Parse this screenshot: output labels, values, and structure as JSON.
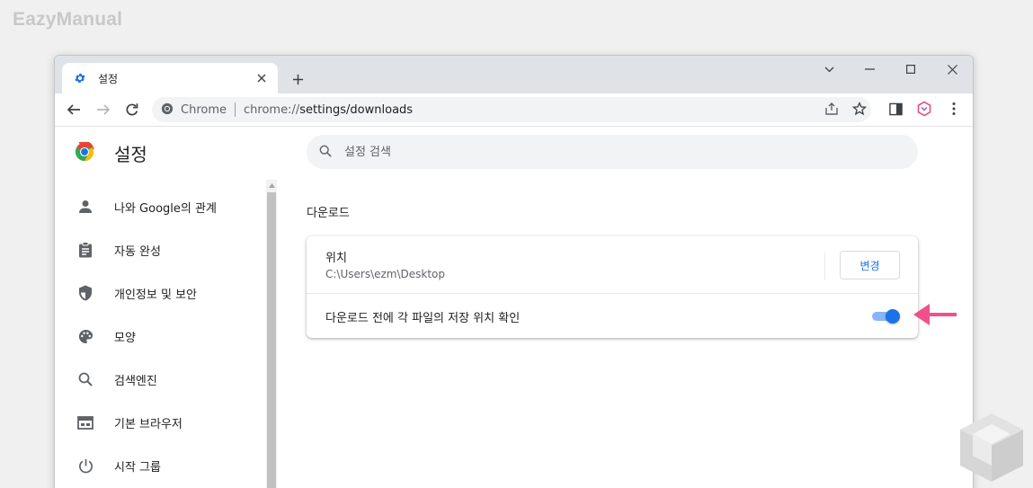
{
  "brand": "EazyManual",
  "browser": {
    "tab_title": "설정",
    "address": {
      "chip": "Chrome",
      "url_prefix": "chrome://",
      "url_path": "settings/downloads"
    }
  },
  "settings": {
    "title": "설정",
    "search_placeholder": "설정 검색",
    "sidebar": [
      {
        "label": "나와 Google의 관계",
        "icon": "person-icon"
      },
      {
        "label": "자동 완성",
        "icon": "clipboard-icon"
      },
      {
        "label": "개인정보 및 보안",
        "icon": "shield-icon"
      },
      {
        "label": "모양",
        "icon": "palette-icon"
      },
      {
        "label": "검색엔진",
        "icon": "search-icon"
      },
      {
        "label": "기본 브라우저",
        "icon": "browser-icon"
      },
      {
        "label": "시작 그룹",
        "icon": "power-icon"
      }
    ],
    "downloads": {
      "section_title": "다운로드",
      "location_label": "위치",
      "location_path": "C:\\Users\\ezm\\Desktop",
      "change_button": "변경",
      "ask_label": "다운로드 전에 각 파일의 저장 위치 확인",
      "ask_enabled": true
    }
  },
  "colors": {
    "accent": "#1a73e8",
    "annotation_arrow": "#f0508c"
  }
}
